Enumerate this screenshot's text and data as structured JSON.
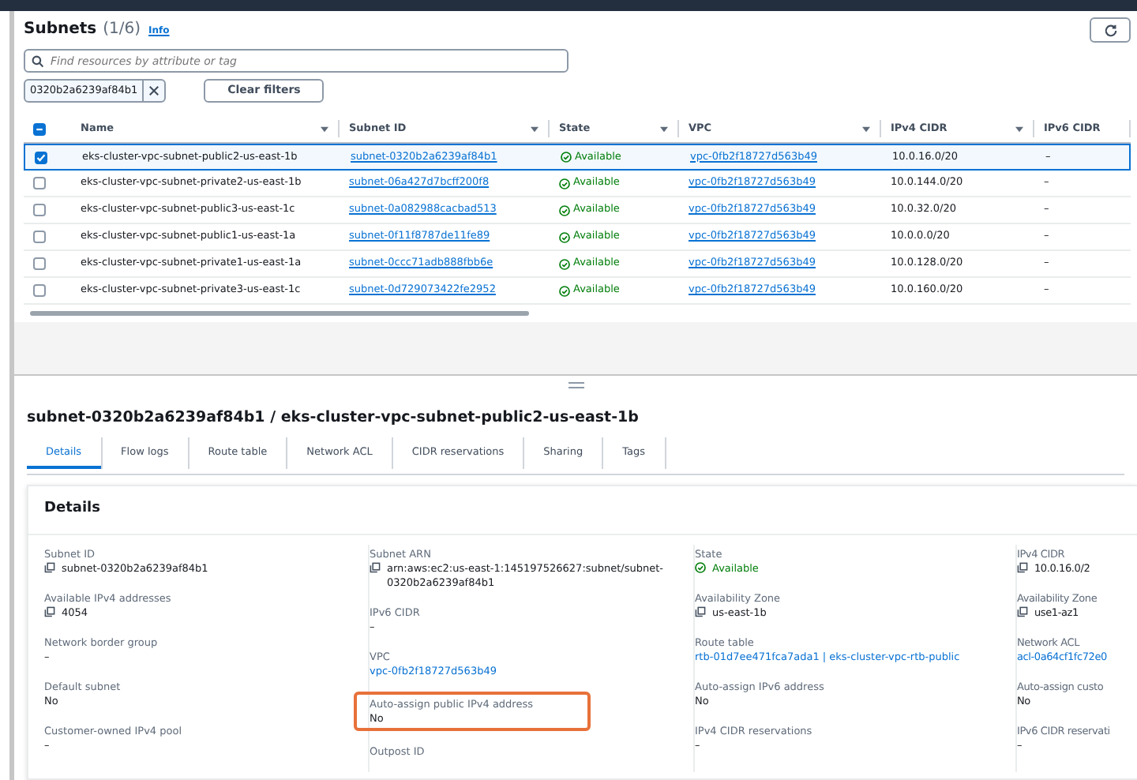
{
  "header": {
    "title": "Subnets",
    "count": "(1/6)",
    "info": "Info"
  },
  "search": {
    "placeholder": "Find resources by attribute or tag"
  },
  "filter_token": {
    "label": "0320b2a6239af84b1"
  },
  "clear_filters": "Clear filters",
  "table": {
    "select_all": {
      "indeterminate": true
    },
    "columns": [
      "Name",
      "Subnet ID",
      "State",
      "VPC",
      "IPv4 CIDR",
      "IPv6 CIDR"
    ],
    "rows": [
      {
        "name": "eks-cluster-vpc-subnet-public2-us-east-1b",
        "subnet_id": "subnet-0320b2a6239af84b1",
        "state": "Available",
        "vpc": "vpc-0fb2f18727d563b49",
        "ipv4_cidr": "10.0.16.0/20",
        "ipv6_cidr": "–",
        "selected": true
      },
      {
        "name": "eks-cluster-vpc-subnet-private2-us-east-1b",
        "subnet_id": "subnet-06a427d7bcff200f8",
        "state": "Available",
        "vpc": "vpc-0fb2f18727d563b49",
        "ipv4_cidr": "10.0.144.0/20",
        "ipv6_cidr": "–",
        "selected": false
      },
      {
        "name": "eks-cluster-vpc-subnet-public3-us-east-1c",
        "subnet_id": "subnet-0a082988cacbad513",
        "state": "Available",
        "vpc": "vpc-0fb2f18727d563b49",
        "ipv4_cidr": "10.0.32.0/20",
        "ipv6_cidr": "–",
        "selected": false
      },
      {
        "name": "eks-cluster-vpc-subnet-public1-us-east-1a",
        "subnet_id": "subnet-0f11f8787de11fe89",
        "state": "Available",
        "vpc": "vpc-0fb2f18727d563b49",
        "ipv4_cidr": "10.0.0.0/20",
        "ipv6_cidr": "–",
        "selected": false
      },
      {
        "name": "eks-cluster-vpc-subnet-private1-us-east-1a",
        "subnet_id": "subnet-0ccc71adb888fbb6e",
        "state": "Available",
        "vpc": "vpc-0fb2f18727d563b49",
        "ipv4_cidr": "10.0.128.0/20",
        "ipv6_cidr": "–",
        "selected": false
      },
      {
        "name": "eks-cluster-vpc-subnet-private3-us-east-1c",
        "subnet_id": "subnet-0d729073422fe2952",
        "state": "Available",
        "vpc": "vpc-0fb2f18727d563b49",
        "ipv4_cidr": "10.0.160.0/20",
        "ipv6_cidr": "–",
        "selected": false
      }
    ]
  },
  "detail": {
    "title": "subnet-0320b2a6239af84b1 / eks-cluster-vpc-subnet-public2-us-east-1b",
    "tabs": [
      {
        "label": "Details",
        "selected": true
      },
      {
        "label": "Flow logs",
        "selected": false
      },
      {
        "label": "Route table",
        "selected": false
      },
      {
        "label": "Network ACL",
        "selected": false
      },
      {
        "label": "CIDR reservations",
        "selected": false
      },
      {
        "label": "Sharing",
        "selected": false
      },
      {
        "label": "Tags",
        "selected": false
      }
    ],
    "panel_title": "Details",
    "columns": [
      [
        {
          "label": "Subnet ID",
          "value": "subnet-0320b2a6239af84b1",
          "kind": "copy",
          "highlighted": false
        },
        {
          "label": "Available IPv4 addresses",
          "value": "4054",
          "kind": "copy",
          "highlighted": false
        },
        {
          "label": "Network border group",
          "value": "–",
          "kind": "text",
          "highlighted": false
        },
        {
          "label": "Default subnet",
          "value": "No",
          "kind": "text",
          "highlighted": false
        },
        {
          "label": "Customer-owned IPv4 pool",
          "value": "–",
          "kind": "text",
          "highlighted": false
        }
      ],
      [
        {
          "label": "Subnet ARN",
          "value": "arn:aws:ec2:us-east-1:145197526627:subnet/subnet-0320b2a6239af84b1",
          "kind": "copy",
          "highlighted": false
        },
        {
          "label": "IPv6 CIDR",
          "value": "–",
          "kind": "text",
          "highlighted": false
        },
        {
          "label": "VPC",
          "value": "vpc-0fb2f18727d563b49",
          "kind": "link",
          "highlighted": false
        },
        {
          "label": "Auto-assign public IPv4 address",
          "value": "No",
          "kind": "text",
          "highlighted": true
        },
        {
          "label": "Outpost ID",
          "highlighted": false
        }
      ],
      [
        {
          "label": "State",
          "value": "Available",
          "kind": "status",
          "highlighted": false
        },
        {
          "label": "Availability Zone",
          "value": "us-east-1b",
          "kind": "copy",
          "highlighted": false
        },
        {
          "label": "Route table",
          "value": "rtb-01d7ee471fca7ada1 | eks-cluster-vpc-rtb-public",
          "kind": "link",
          "highlighted": false
        },
        {
          "label": "Auto-assign IPv6 address",
          "value": "No",
          "kind": "text",
          "highlighted": false
        },
        {
          "label": "IPv4 CIDR reservations",
          "value": "–",
          "kind": "text",
          "highlighted": false
        }
      ],
      [
        {
          "label": "IPv4 CIDR",
          "value": "10.0.16.0/2",
          "kind": "copy",
          "highlighted": false
        },
        {
          "label": "Availability Zone",
          "value": "use1-az1",
          "kind": "copy",
          "highlighted": false
        },
        {
          "label": "Network ACL",
          "value": "acl-0a64cf1fc72e0",
          "kind": "link",
          "highlighted": false
        },
        {
          "label": "Auto-assign custo",
          "value": "No",
          "kind": "text",
          "highlighted": false
        },
        {
          "label": "IPv6 CIDR reservati",
          "value": "–",
          "kind": "text",
          "highlighted": false
        }
      ]
    ]
  }
}
